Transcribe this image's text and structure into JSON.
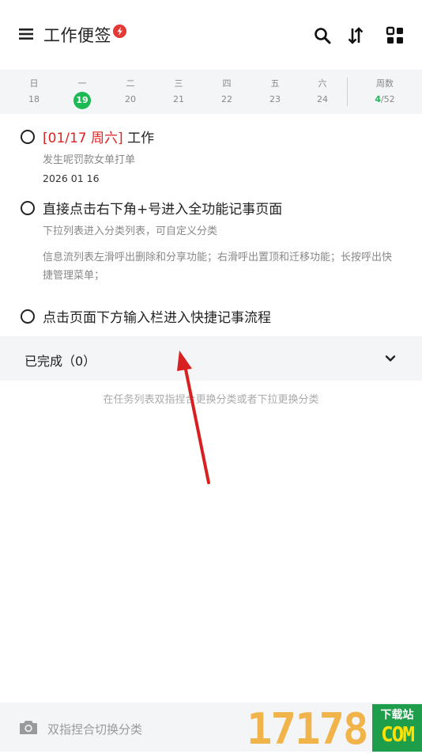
{
  "header": {
    "title": "工作便签",
    "menu_icon": "hamburger-menu-icon",
    "badge_icon": "lightning-badge-icon",
    "badge_color": "#e53935",
    "actions": [
      "search-icon",
      "sort-icon",
      "grid-icon"
    ]
  },
  "calendar": {
    "days": [
      {
        "weekday": "日",
        "date": "18"
      },
      {
        "weekday": "一",
        "date": "19"
      },
      {
        "weekday": "二",
        "date": "20"
      },
      {
        "weekday": "三",
        "date": "21"
      },
      {
        "weekday": "四",
        "date": "22"
      },
      {
        "weekday": "五",
        "date": "23"
      },
      {
        "weekday": "六",
        "date": "24"
      }
    ],
    "today_date": "19",
    "today_color": "#1db954",
    "weeks_label": "周数",
    "week_current": "4",
    "week_total": "/52"
  },
  "tasks": [
    {
      "date_tag": "[01/17 周六]",
      "title": "工作",
      "subtitle": "发生呢罚款女单打单",
      "date": "2026 01 16"
    },
    {
      "title": "直接点击右下角+号进入全功能记事页面",
      "subtitle": "下拉列表进入分类列表，可自定义分类",
      "note": "信息流列表左滑呼出删除和分享功能；右滑呼出置顶和迁移功能；长按呼出快捷管理菜单；"
    },
    {
      "title": "点击页面下方输入栏进入快捷记事流程"
    }
  ],
  "completed": {
    "label": "已完成（0）",
    "icon": "chevron-down-icon"
  },
  "hint": "在任务列表双指捏合更换分类或者下拉更换分类",
  "bottom": {
    "icon": "camera-icon",
    "placeholder": "双指捏合切换分类"
  },
  "watermark": {
    "number": "17178",
    "top_text": "下载站",
    "bottom_text": "COM"
  },
  "accent_red": "#e02020"
}
